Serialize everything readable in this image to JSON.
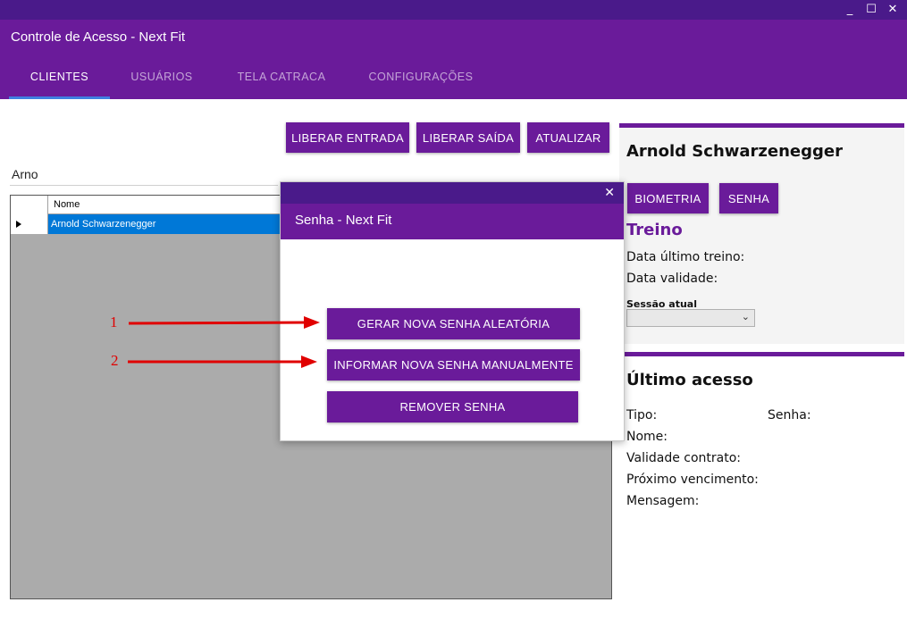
{
  "window": {
    "minimize_glyph": "_",
    "maximize_glyph": "☐",
    "close_glyph": "✕"
  },
  "app_title": "Controle de Acesso - Next Fit",
  "tabs": [
    {
      "label": "CLIENTES",
      "active": true
    },
    {
      "label": "USUÁRIOS",
      "active": false
    },
    {
      "label": "TELA CATRACA",
      "active": false
    },
    {
      "label": "CONFIGURAÇÕES",
      "active": false
    }
  ],
  "toolbar": {
    "liberar_entrada": "LIBERAR ENTRADA",
    "liberar_saida": "LIBERAR SAÍDA",
    "atualizar": "ATUALIZAR"
  },
  "search": {
    "value": "Arno"
  },
  "grid": {
    "columns": [
      "Nome"
    ],
    "rows": [
      {
        "nome": "Arnold Schwarzenegger",
        "selected": true
      }
    ]
  },
  "client_panel": {
    "name": "Arnold Schwarzenegger",
    "biometria_button": "BIOMETRIA",
    "senha_button": "SENHA",
    "treino_heading": "Treino",
    "data_ultimo_treino_label": "Data último treino:",
    "data_validade_label": "Data validade:",
    "sessao_atual_label": "Sessão atual",
    "sessao_atual_value": ""
  },
  "last_access_panel": {
    "title": "Último acesso",
    "tipo_label": "Tipo:",
    "senha_label": "Senha:",
    "nome_label": "Nome:",
    "validade_contrato_label": "Validade contrato:",
    "proximo_vencimento_label": "Próximo vencimento:",
    "mensagem_label": "Mensagem:"
  },
  "modal": {
    "close_glyph": "✕",
    "title": "Senha - Next Fit",
    "buttons": {
      "gerar": "GERAR NOVA SENHA ALEATÓRIA",
      "informar": "INFORMAR NOVA SENHA MANUALMENTE",
      "remover": "REMOVER SENHA"
    }
  },
  "annotations": {
    "one": "1",
    "two": "2",
    "color": "#e00000"
  },
  "colors": {
    "primary": "#6a1b9a",
    "titlebar": "#4a1a8a",
    "tab_indicator": "#3f7fe0",
    "selection": "#0078d7"
  }
}
